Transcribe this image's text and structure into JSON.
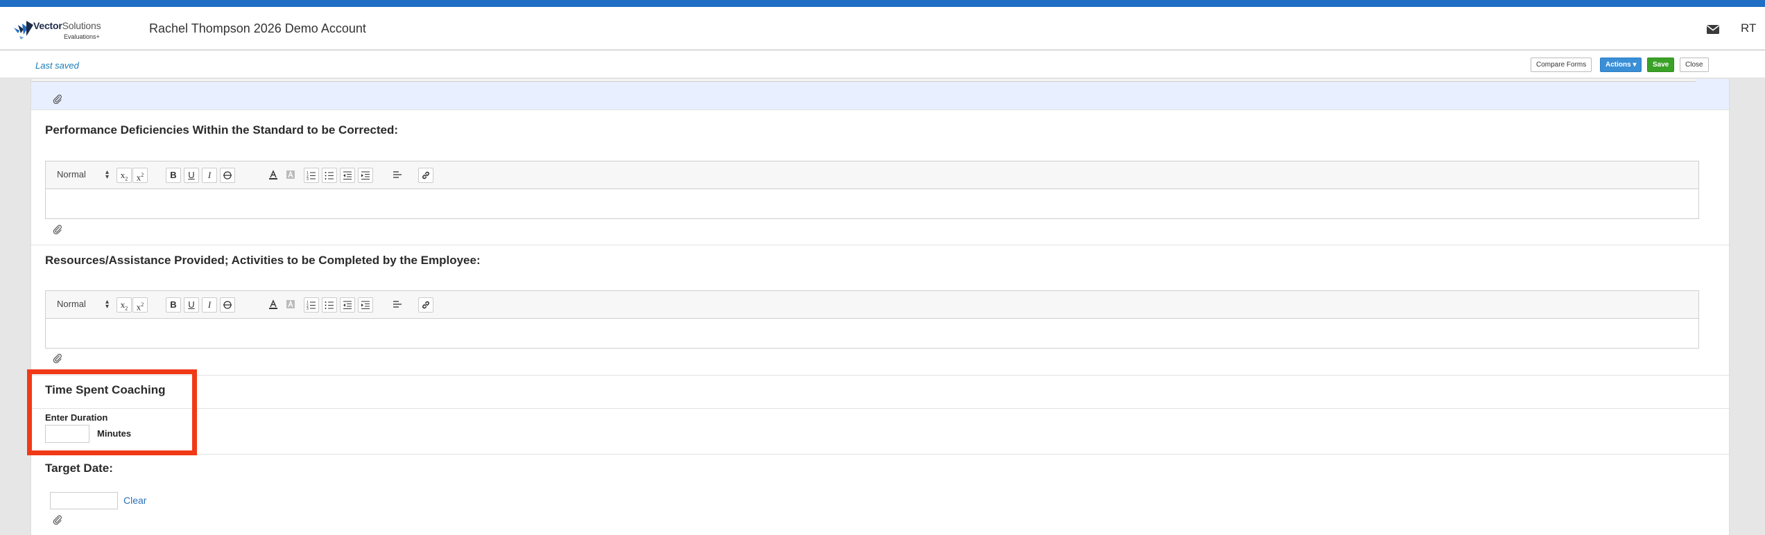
{
  "header": {
    "logo_brand_bold": "Vector",
    "logo_brand_rest": "Solutions",
    "logo_sub": "Evaluations+",
    "account_title": "Rachel Thompson 2026 Demo Account",
    "user_initials": "RT",
    "mail_icon": "envelope-icon"
  },
  "subbar": {
    "status": "Last saved",
    "buttons": {
      "compare": "Compare Forms",
      "actions": "Actions ▾",
      "save": "Save",
      "close": "Close"
    }
  },
  "colors": {
    "topbar": "#1f6ec4",
    "save": "#3aa227",
    "actions": "#3a8fd6",
    "highlight": "#f03a17",
    "link": "#2a6fbb"
  },
  "editor_toolbar": {
    "format_value": "Normal",
    "buttons": [
      "subscript",
      "superscript",
      "bold",
      "underline",
      "italic",
      "strikethrough",
      "font-color",
      "background-color",
      "ordered-list",
      "bullet-list",
      "indent-decrease",
      "indent-increase",
      "align",
      "link"
    ]
  },
  "sections": {
    "deficiencies": {
      "title": "Performance Deficiencies Within the Standard to be Corrected:"
    },
    "resources": {
      "title": "Resources/Assistance Provided; Activities to be Completed by the Employee:"
    },
    "coaching": {
      "title": "Time Spent Coaching",
      "duration_label": "Enter Duration",
      "duration_value": "",
      "unit_label": "Minutes"
    },
    "target_date": {
      "title": "Target Date:",
      "date_value": "",
      "clear_label": "Clear"
    }
  }
}
